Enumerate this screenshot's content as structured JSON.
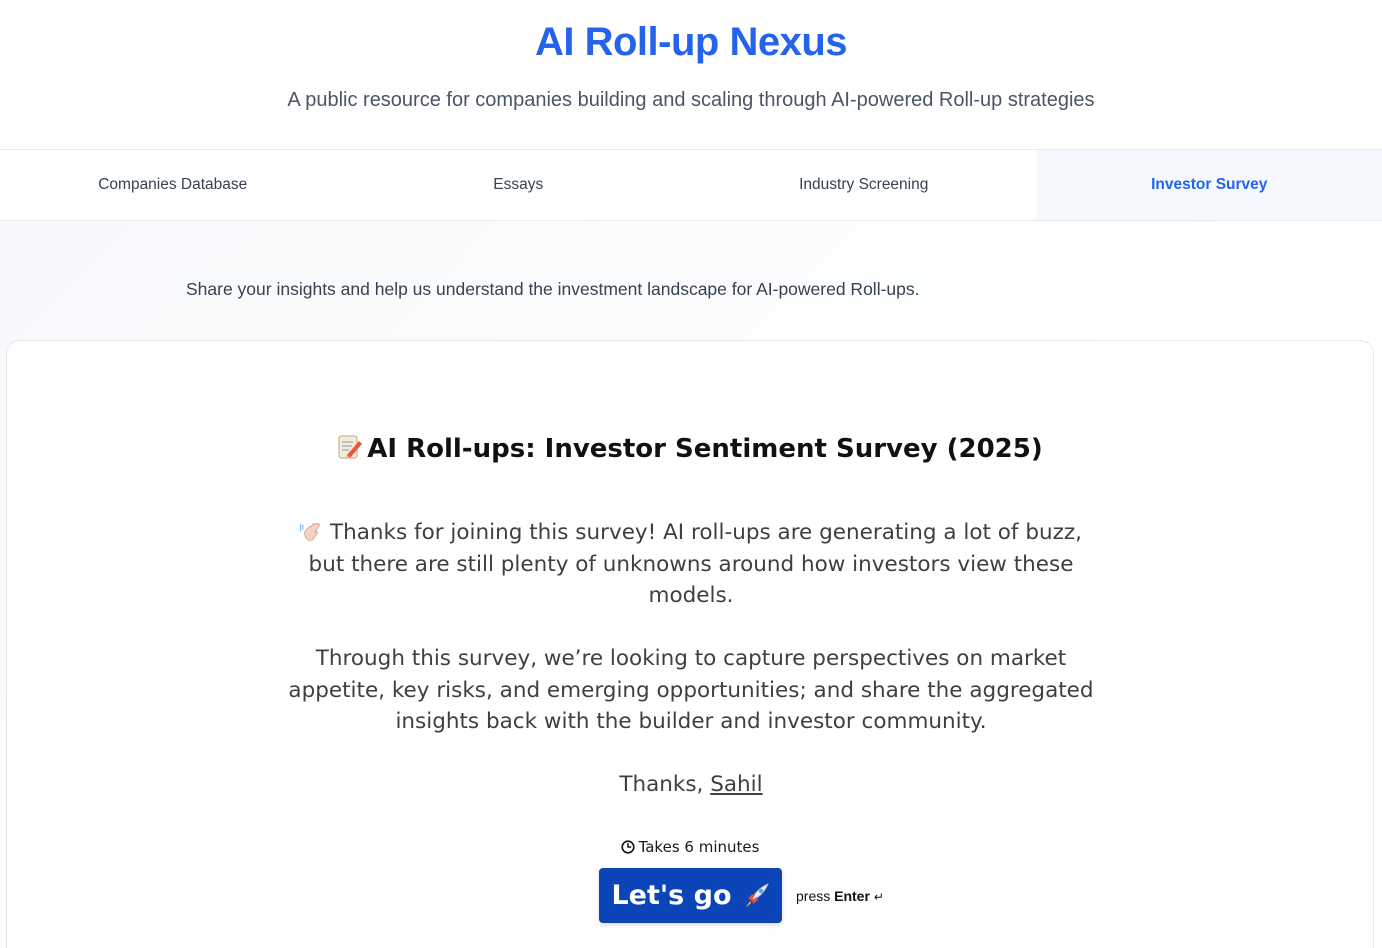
{
  "header": {
    "title": "AI Roll-up Nexus",
    "subtitle": "A public resource for companies building and scaling through AI-powered Roll-up strategies"
  },
  "tabs": [
    {
      "label": "Companies Database",
      "active": false
    },
    {
      "label": "Essays",
      "active": false
    },
    {
      "label": "Industry Screening",
      "active": false
    },
    {
      "label": "Investor Survey",
      "active": true
    }
  ],
  "main": {
    "intro": "Share your insights and help us understand the investment landscape for AI-powered Roll-ups."
  },
  "survey": {
    "title_icon": "memo-icon",
    "title": "AI Roll-ups: Investor Sentiment Survey (2025)",
    "wave_icon": "waving-hand-icon",
    "paragraph1": "Thanks for joining this survey! AI roll-ups are generating a lot of buzz, but there are still plenty of unknowns around how investors view these models.",
    "paragraph2": "Through this survey, we’re looking to capture perspectives on market appetite, key risks, and emerging opportunities; and share the aggregated insights back with the builder and investor community.",
    "sign_prefix": "Thanks, ",
    "sign_name": "Sahil",
    "time_note": "Takes 6 minutes",
    "start_button": "Let's go",
    "start_icon": "rocket-icon",
    "hint_prefix": "press",
    "hint_key": "Enter",
    "hint_icon": "↵"
  },
  "colors": {
    "accent": "#2563eb",
    "button": "#0b45b8",
    "active_tab_bg": "#f5f8fc"
  }
}
